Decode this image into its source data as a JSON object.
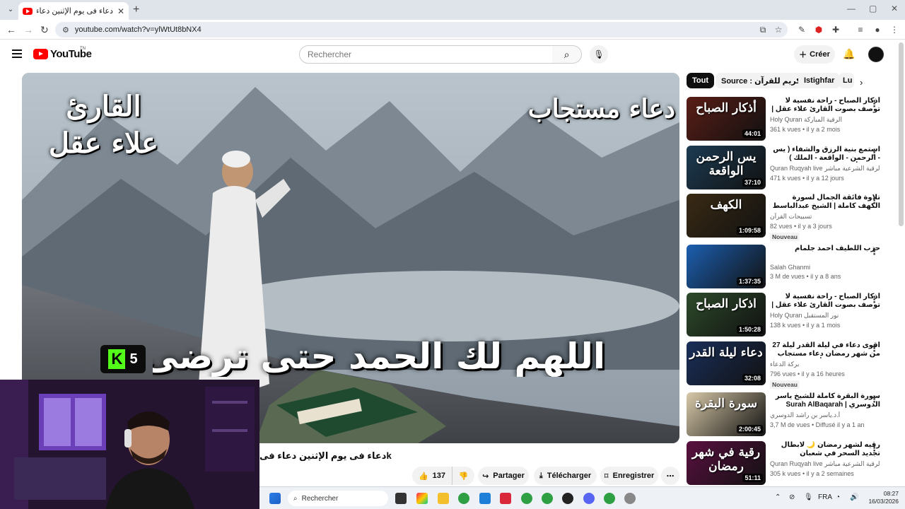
{
  "browser": {
    "tab_title": "دعاء فى يوم الإثنين دعاء فى يوم '",
    "tab_close": "✕",
    "new_tab": "+",
    "url": "youtube.com/watch?v=ylWtUt8bNX4",
    "window_controls": [
      "—",
      "▢",
      "✕"
    ]
  },
  "youtube": {
    "logo_text": "YouTube",
    "logo_region": "TN",
    "search_placeholder": "Rechercher",
    "create_label": "Créer"
  },
  "video": {
    "overlay_reader_line1": "القارئ",
    "overlay_reader_line2": "علاء عقل",
    "overlay_dua": "دعاء مستجاب",
    "overlay_hamd": "اللهم لك الحمد حتى ترضى",
    "kick_count": "5",
    "title": "kدعاء فى يوم الإثنين دعاء فى",
    "likes": "137",
    "share_label": "Partager",
    "download_label": "Télécharger",
    "save_label": "Enregistrer"
  },
  "chips": [
    "Tout",
    "Source : القرآن الكريم للقرآن",
    "Istighfar",
    "Lu"
  ],
  "related": [
    {
      "thumb_text": "أذكار الصباح",
      "duration": "44:01",
      "title": "أذكار الصباح - راحة نفسية لا توصف بصوت القارئ علاء عقل | Morning Athkar",
      "channel": "Holy Quran الرقية المباركة",
      "stats": "361 k vues • il y a 2 mois",
      "badge": "",
      "color": "#5a1d16"
    },
    {
      "thumb_text": "يس الرحمن الواقعة",
      "duration": "37:10",
      "title": "استمع بنية الرزق والشفاء ( يس - الرحمن - الواقعة - الملك ) الشيخ أحمد العجمي",
      "channel": "Quran Ruqyah live الرقية الشرعية مباشر",
      "stats": "471 k vues • il y a 12 jours",
      "badge": "",
      "color": "#1c3b52"
    },
    {
      "thumb_text": "الكهف",
      "duration": "1:09:58",
      "title": "تلاوة فائقة الجمال لسورة الكهف كاملة | الشيخ عبدالباسط عبدالصمد | SURAH AL",
      "channel": "تسبيحات القرآن",
      "stats": "82 vues • il y a 3 jours",
      "badge": "Nouveau",
      "color": "#3a2a14"
    },
    {
      "thumb_text": "",
      "duration": "1:37:35",
      "title": "حزب اللطيف  احمد جلمام",
      "channel": "Salah Ghanmi",
      "stats": "3 M de vues • il y a 8 ans",
      "badge": "",
      "color": "#1c5fb0"
    },
    {
      "thumb_text": "اذكار الصباح",
      "duration": "1:50:28",
      "title": "أذكار الصباح - راحة نفسية لا توصف بصوت القارئ علاء عقل | Morning Athkar",
      "channel": "Holy Quran نور المستقبل",
      "stats": "138 k vues • il y a 1 mois",
      "badge": "",
      "color": "#2d4a2a"
    },
    {
      "thumb_text": "دعاء ليلة القدر",
      "duration": "32:08",
      "title": "أقوى دعاء في ليلة القدر ليلة 27 من شهر رمضان دعاء مستجاب بإذن الله - للشيخ أيوب",
      "channel": "بركة الدعاء",
      "stats": "796 vues • il y a 16 heures",
      "badge": "Nouveau",
      "color": "#1a2f5a"
    },
    {
      "thumb_text": "سورة البقرة",
      "duration": "2:00:45",
      "title": "سورة البقرة كاملة للشيخ ياسر الدوسري | Surah AlBaqarah",
      "channel": "أ.د.ياسر بن راشد الدوسري",
      "stats": "3,7 M de vues • Diffusé il y a 1 an",
      "badge": "",
      "color": "#d8c9a8"
    },
    {
      "thumb_text": "رقية في شهر رمضان",
      "duration": "51:11",
      "title": "رقيه لشهر رمضان 🌙 لابطال تجديد السحر في شعبان والتحصين الشديد وقطع ارسال",
      "channel": "Quran Ruqyah live الرقية الشرعية مباشر",
      "stats": "305 k vues • il y a 2 semaines",
      "badge": "",
      "color": "#5a1040"
    }
  ],
  "taskbar": {
    "search_label": "Rechercher",
    "lang": "FRA",
    "time": "08:27",
    "date": "16/03/2026"
  }
}
